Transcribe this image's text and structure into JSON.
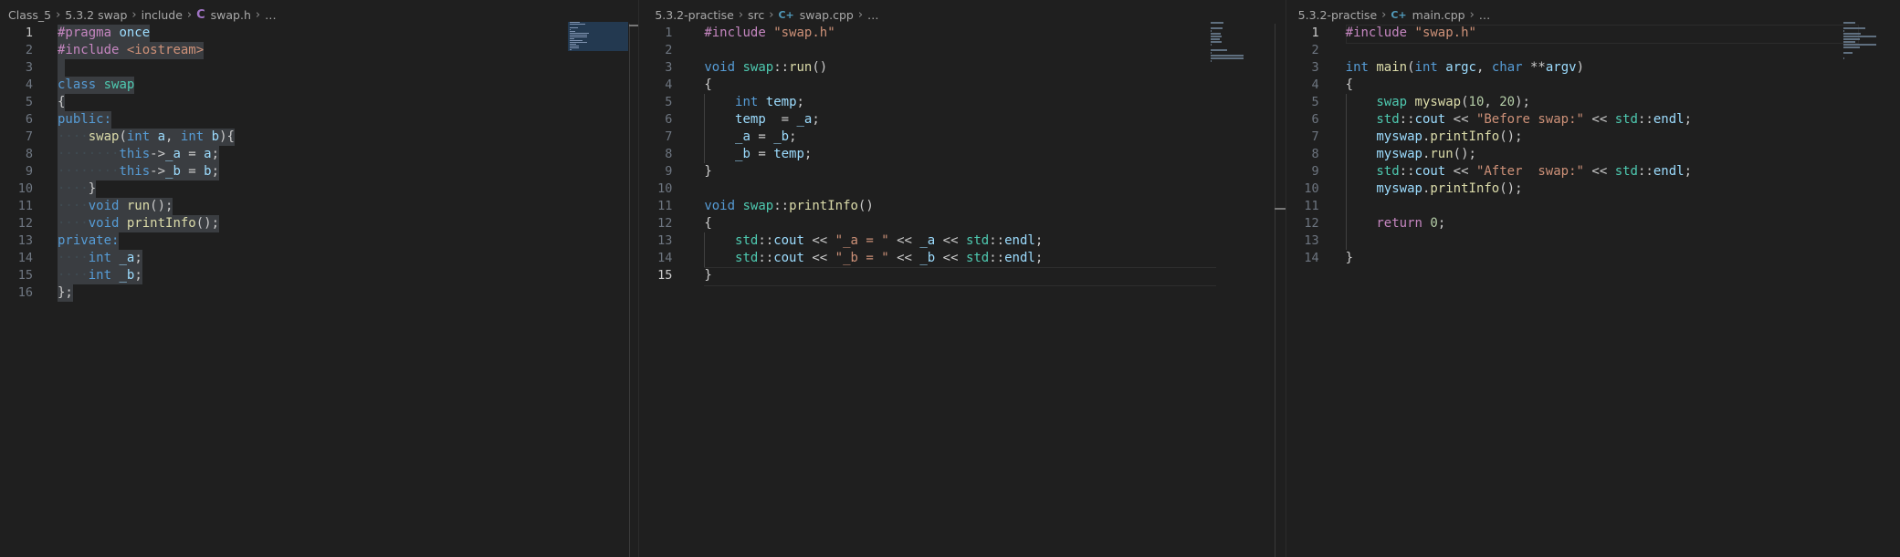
{
  "colors": {
    "background": "#1f1f1f",
    "keyword": "#569cd6",
    "control": "#c586c0",
    "type": "#4ec9b0",
    "function": "#dcdcaa",
    "string": "#ce9178",
    "number": "#b5cea8",
    "variable": "#9cdcfe",
    "selection": "#3a3d41"
  },
  "panes": [
    {
      "breadcrumb": [
        "Class_5",
        "5.3.2 swap",
        "include",
        "swap.h",
        "…"
      ],
      "file_icon": "c-header-icon",
      "file_icon_glyph": "C",
      "active_line": 1,
      "lines": [
        "1",
        "2",
        "3",
        "4",
        "5",
        "6",
        "7",
        "8",
        "9",
        "10",
        "11",
        "12",
        "13",
        "14",
        "15",
        "16"
      ]
    },
    {
      "breadcrumb": [
        "5.3.2-practise",
        "src",
        "swap.cpp",
        "…"
      ],
      "file_icon": "cpp-file-icon",
      "file_icon_glyph": "C+",
      "active_line": 15,
      "lines": [
        "1",
        "2",
        "3",
        "4",
        "5",
        "6",
        "7",
        "8",
        "9",
        "10",
        "11",
        "12",
        "13",
        "14",
        "15"
      ]
    },
    {
      "breadcrumb": [
        "5.3.2-practise",
        "main.cpp",
        "…"
      ],
      "file_icon": "cpp-file-icon",
      "file_icon_glyph": "C+",
      "active_line": 1,
      "lines": [
        "1",
        "2",
        "3",
        "4",
        "5",
        "6",
        "7",
        "8",
        "9",
        "10",
        "11",
        "12",
        "13",
        "14"
      ]
    }
  ],
  "code": {
    "swap_h": [
      [
        [
          "pp",
          "#pragma"
        ],
        [
          "plain",
          " "
        ],
        [
          "var",
          "once"
        ]
      ],
      [
        [
          "pp",
          "#include"
        ],
        [
          "plain",
          " "
        ],
        [
          "str",
          "<iostream>"
        ]
      ],
      [],
      [
        [
          "kw",
          "class"
        ],
        [
          "plain",
          " "
        ],
        [
          "ty",
          "swap"
        ]
      ],
      [
        [
          "plain",
          "{"
        ]
      ],
      [
        [
          "kw",
          "public:"
        ]
      ],
      [
        [
          "ws",
          "····"
        ],
        [
          "fn",
          "swap"
        ],
        [
          "plain",
          "("
        ],
        [
          "kw",
          "int"
        ],
        [
          "plain",
          " "
        ],
        [
          "var",
          "a"
        ],
        [
          "plain",
          ", "
        ],
        [
          "kw",
          "int"
        ],
        [
          "plain",
          " "
        ],
        [
          "var",
          "b"
        ],
        [
          "plain",
          "){"
        ]
      ],
      [
        [
          "ws",
          "········"
        ],
        [
          "kw",
          "this"
        ],
        [
          "plain",
          "->"
        ],
        [
          "var",
          "_a"
        ],
        [
          "plain",
          " = "
        ],
        [
          "var",
          "a"
        ],
        [
          "plain",
          ";"
        ]
      ],
      [
        [
          "ws",
          "········"
        ],
        [
          "kw",
          "this"
        ],
        [
          "plain",
          "->"
        ],
        [
          "var",
          "_b"
        ],
        [
          "plain",
          " = "
        ],
        [
          "var",
          "b"
        ],
        [
          "plain",
          ";"
        ]
      ],
      [
        [
          "ws",
          "····"
        ],
        [
          "plain",
          "}"
        ]
      ],
      [
        [
          "ws",
          "····"
        ],
        [
          "kw",
          "void"
        ],
        [
          "plain",
          " "
        ],
        [
          "fn",
          "run"
        ],
        [
          "plain",
          "();"
        ]
      ],
      [
        [
          "ws",
          "····"
        ],
        [
          "kw",
          "void"
        ],
        [
          "plain",
          " "
        ],
        [
          "fn",
          "printInfo"
        ],
        [
          "plain",
          "();"
        ]
      ],
      [
        [
          "kw",
          "private:"
        ]
      ],
      [
        [
          "ws",
          "····"
        ],
        [
          "kw",
          "int"
        ],
        [
          "plain",
          " "
        ],
        [
          "var",
          "_a"
        ],
        [
          "plain",
          ";"
        ]
      ],
      [
        [
          "ws",
          "····"
        ],
        [
          "kw",
          "int"
        ],
        [
          "plain",
          " "
        ],
        [
          "var",
          "_b"
        ],
        [
          "plain",
          ";"
        ]
      ],
      [
        [
          "plain",
          "};"
        ]
      ]
    ],
    "swap_cpp": [
      [
        [
          "pp",
          "#include"
        ],
        [
          "plain",
          " "
        ],
        [
          "str",
          "\"swap.h\""
        ]
      ],
      [],
      [
        [
          "kw",
          "void"
        ],
        [
          "plain",
          " "
        ],
        [
          "ty",
          "swap"
        ],
        [
          "plain",
          "::"
        ],
        [
          "fn",
          "run"
        ],
        [
          "plain",
          "()"
        ]
      ],
      [
        [
          "plain",
          "{"
        ]
      ],
      [
        [
          "plain",
          "    "
        ],
        [
          "kw",
          "int"
        ],
        [
          "plain",
          " "
        ],
        [
          "var",
          "temp"
        ],
        [
          "plain",
          ";"
        ]
      ],
      [
        [
          "plain",
          "    "
        ],
        [
          "var",
          "temp"
        ],
        [
          "plain",
          "  = "
        ],
        [
          "var",
          "_a"
        ],
        [
          "plain",
          ";"
        ]
      ],
      [
        [
          "plain",
          "    "
        ],
        [
          "var",
          "_a"
        ],
        [
          "plain",
          " = "
        ],
        [
          "var",
          "_b"
        ],
        [
          "plain",
          ";"
        ]
      ],
      [
        [
          "plain",
          "    "
        ],
        [
          "var",
          "_b"
        ],
        [
          "plain",
          " = "
        ],
        [
          "var",
          "temp"
        ],
        [
          "plain",
          ";"
        ]
      ],
      [
        [
          "plain",
          "}"
        ]
      ],
      [],
      [
        [
          "kw",
          "void"
        ],
        [
          "plain",
          " "
        ],
        [
          "ty",
          "swap"
        ],
        [
          "plain",
          "::"
        ],
        [
          "fn",
          "printInfo"
        ],
        [
          "plain",
          "()"
        ]
      ],
      [
        [
          "plain",
          "{"
        ]
      ],
      [
        [
          "plain",
          "    "
        ],
        [
          "ty",
          "std"
        ],
        [
          "plain",
          "::"
        ],
        [
          "var",
          "cout"
        ],
        [
          "plain",
          " << "
        ],
        [
          "str",
          "\"_a = \""
        ],
        [
          "plain",
          " << "
        ],
        [
          "var",
          "_a"
        ],
        [
          "plain",
          " << "
        ],
        [
          "ty",
          "std"
        ],
        [
          "plain",
          "::"
        ],
        [
          "var",
          "endl"
        ],
        [
          "plain",
          ";"
        ]
      ],
      [
        [
          "plain",
          "    "
        ],
        [
          "ty",
          "std"
        ],
        [
          "plain",
          "::"
        ],
        [
          "var",
          "cout"
        ],
        [
          "plain",
          " << "
        ],
        [
          "str",
          "\"_b = \""
        ],
        [
          "plain",
          " << "
        ],
        [
          "var",
          "_b"
        ],
        [
          "plain",
          " << "
        ],
        [
          "ty",
          "std"
        ],
        [
          "plain",
          "::"
        ],
        [
          "var",
          "endl"
        ],
        [
          "plain",
          ";"
        ]
      ],
      [
        [
          "plain",
          "}"
        ]
      ]
    ],
    "main_cpp": [
      [
        [
          "pp",
          "#include"
        ],
        [
          "plain",
          " "
        ],
        [
          "str",
          "\"swap.h\""
        ]
      ],
      [],
      [
        [
          "kw",
          "int"
        ],
        [
          "plain",
          " "
        ],
        [
          "fn",
          "main"
        ],
        [
          "plain",
          "("
        ],
        [
          "kw",
          "int"
        ],
        [
          "plain",
          " "
        ],
        [
          "var",
          "argc"
        ],
        [
          "plain",
          ", "
        ],
        [
          "kw",
          "char"
        ],
        [
          "plain",
          " **"
        ],
        [
          "var",
          "argv"
        ],
        [
          "plain",
          ")"
        ]
      ],
      [
        [
          "plain",
          "{"
        ]
      ],
      [
        [
          "plain",
          "    "
        ],
        [
          "ty",
          "swap"
        ],
        [
          "plain",
          " "
        ],
        [
          "fn",
          "myswap"
        ],
        [
          "plain",
          "("
        ],
        [
          "num",
          "10"
        ],
        [
          "plain",
          ", "
        ],
        [
          "num",
          "20"
        ],
        [
          "plain",
          ");"
        ]
      ],
      [
        [
          "plain",
          "    "
        ],
        [
          "ty",
          "std"
        ],
        [
          "plain",
          "::"
        ],
        [
          "var",
          "cout"
        ],
        [
          "plain",
          " << "
        ],
        [
          "str",
          "\"Before swap:\""
        ],
        [
          "plain",
          " << "
        ],
        [
          "ty",
          "std"
        ],
        [
          "plain",
          "::"
        ],
        [
          "var",
          "endl"
        ],
        [
          "plain",
          ";"
        ]
      ],
      [
        [
          "plain",
          "    "
        ],
        [
          "var",
          "myswap"
        ],
        [
          "plain",
          "."
        ],
        [
          "fn",
          "printInfo"
        ],
        [
          "plain",
          "();"
        ]
      ],
      [
        [
          "plain",
          "    "
        ],
        [
          "var",
          "myswap"
        ],
        [
          "plain",
          "."
        ],
        [
          "fn",
          "run"
        ],
        [
          "plain",
          "();"
        ]
      ],
      [
        [
          "plain",
          "    "
        ],
        [
          "ty",
          "std"
        ],
        [
          "plain",
          "::"
        ],
        [
          "var",
          "cout"
        ],
        [
          "plain",
          " << "
        ],
        [
          "str",
          "\"After  swap:\""
        ],
        [
          "plain",
          " << "
        ],
        [
          "ty",
          "std"
        ],
        [
          "plain",
          "::"
        ],
        [
          "var",
          "endl"
        ],
        [
          "plain",
          ";"
        ]
      ],
      [
        [
          "plain",
          "    "
        ],
        [
          "var",
          "myswap"
        ],
        [
          "plain",
          "."
        ],
        [
          "fn",
          "printInfo"
        ],
        [
          "plain",
          "();"
        ]
      ],
      [],
      [
        [
          "plain",
          "    "
        ],
        [
          "kw2",
          "return"
        ],
        [
          "plain",
          " "
        ],
        [
          "num",
          "0"
        ],
        [
          "plain",
          ";"
        ]
      ],
      [],
      [
        [
          "plain",
          "}"
        ]
      ]
    ]
  }
}
